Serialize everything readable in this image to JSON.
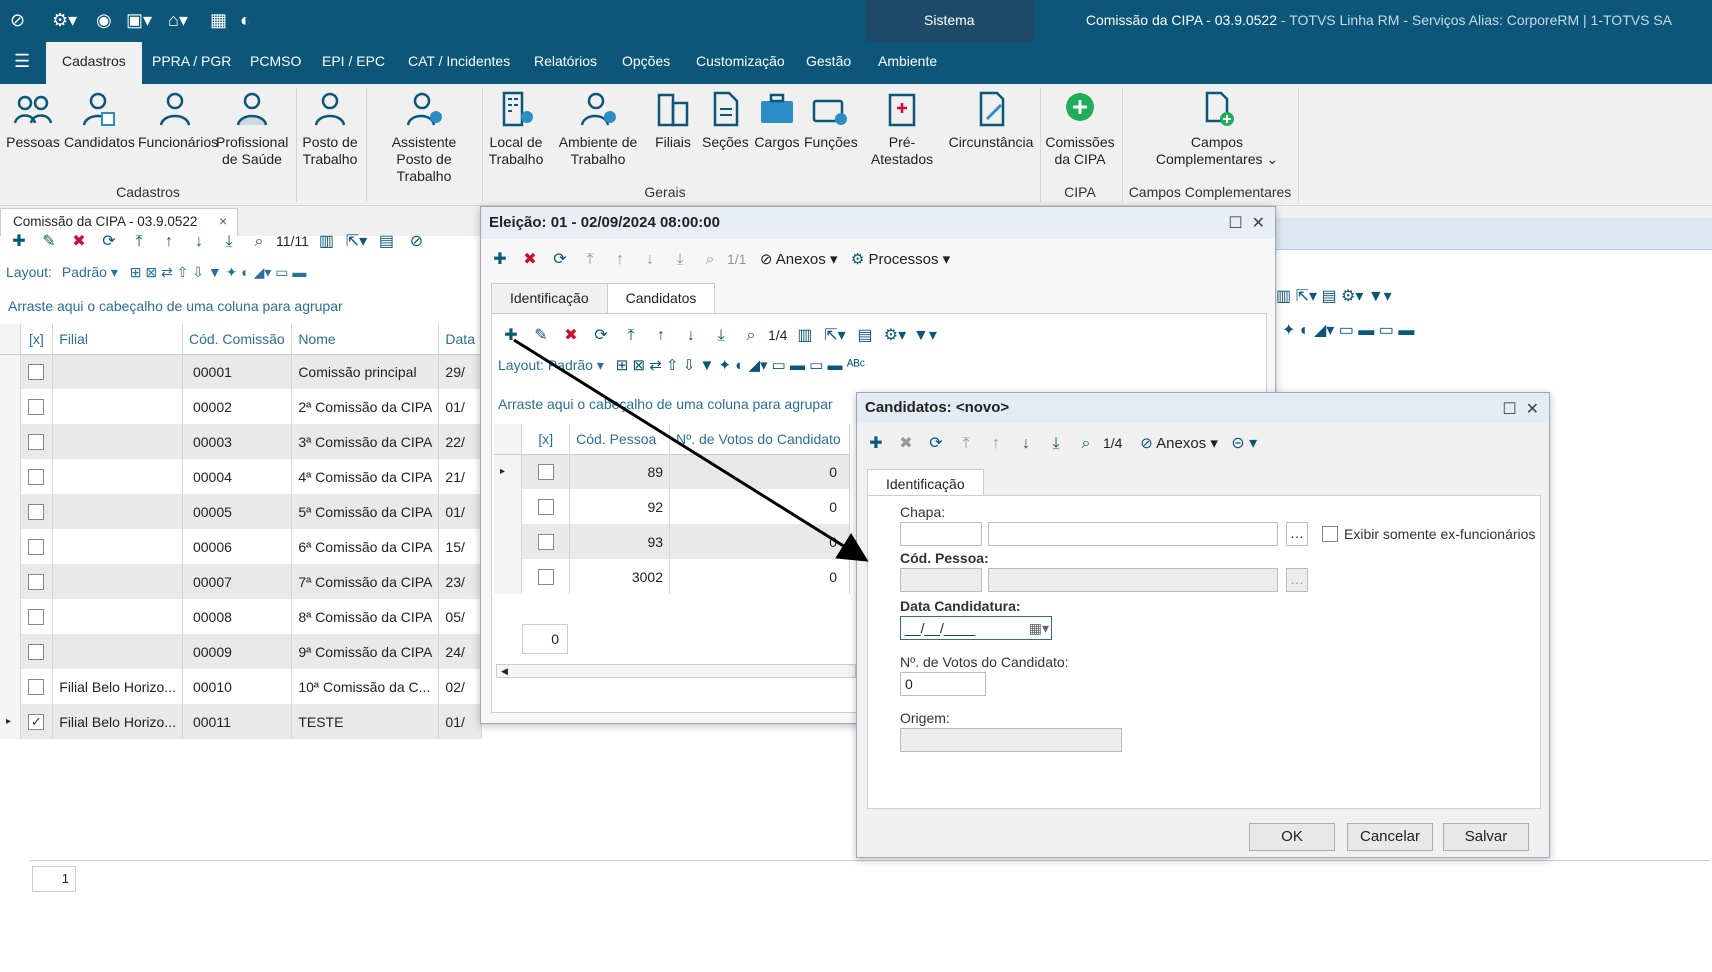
{
  "window": {
    "title_main": "Comissão da CIPA - 03.9.0522",
    "title_rest": " - TOTVS Linha RM - Serviços  Alias: CorporeRM | 1-TOTVS SA",
    "sistema": "Sistema"
  },
  "menu": [
    "Cadastros",
    "PPRA / PGR",
    "PCMSO",
    "EPI / EPC",
    "CAT / Incidentes",
    "Relatórios",
    "Opções",
    "Customização",
    "Gestão",
    "Ambiente"
  ],
  "ribbon": {
    "buttons": [
      "Pessoas",
      "Candidatos",
      "Funcionários",
      "Profissional de Saúde",
      "Posto de Trabalho",
      "Assistente Posto de Trabalho",
      "Local de Trabalho",
      "Ambiente de Trabalho",
      "Filiais",
      "Seções",
      "Cargos",
      "Funções",
      "Pré-Atestados",
      "Circunstância",
      "Comissões da CIPA",
      "Campos Complementares"
    ],
    "groups": [
      "Cadastros",
      "Gerais",
      "CIPA",
      "Campos Complementares"
    ]
  },
  "doctab": {
    "label": "Comissão da CIPA - 03.9.0522",
    "close": "×"
  },
  "main": {
    "record_counter": "11/11",
    "layout_label": "Layout:",
    "layout_value": "Padrão",
    "group_hint": "Arraste aqui o cabeçalho de uma coluna para agrupar",
    "columns": [
      "[x]",
      "Filial",
      "Cód. Comissão",
      "Nome",
      "Data"
    ],
    "rows": [
      {
        "filial": "",
        "cod": "00001",
        "nome": "Comissão principal",
        "data": "29/",
        "checked": false
      },
      {
        "filial": "",
        "cod": "00002",
        "nome": "2ª Comissão da CIPA",
        "data": "01/",
        "checked": false
      },
      {
        "filial": "",
        "cod": "00003",
        "nome": "3ª Comissão da CIPA",
        "data": "22/",
        "checked": false
      },
      {
        "filial": "",
        "cod": "00004",
        "nome": "4ª Comissão da CIPA",
        "data": "21/",
        "checked": false
      },
      {
        "filial": "",
        "cod": "00005",
        "nome": "5ª Comissão da CIPA",
        "data": "01/",
        "checked": false
      },
      {
        "filial": "",
        "cod": "00006",
        "nome": "6ª Comissão da CIPA",
        "data": "15/",
        "checked": false
      },
      {
        "filial": "",
        "cod": "00007",
        "nome": "7ª Comissão da CIPA",
        "data": "23/",
        "checked": false
      },
      {
        "filial": "",
        "cod": "00008",
        "nome": "8ª Comissão da CIPA",
        "data": "05/",
        "checked": false
      },
      {
        "filial": "",
        "cod": "00009",
        "nome": "9ª Comissão da CIPA",
        "data": "24/",
        "checked": false
      },
      {
        "filial": "Filial Belo Horizo...",
        "cod": "00010",
        "nome": "10ª Comissão da C...",
        "data": "02/",
        "checked": false
      },
      {
        "filial": "Filial Belo Horizo...",
        "cod": "00011",
        "nome": "TESTE",
        "data": "01/",
        "checked": true
      }
    ],
    "footer_count": "1"
  },
  "eleicao": {
    "title": "Eleição: 01 - 02/09/2024 08:00:00",
    "counter": "1/1",
    "anexos": "Anexos",
    "processos": "Processos",
    "tabs": [
      "Identificação",
      "Candidatos"
    ],
    "counter2": "1/4",
    "layout_label": "Layout:",
    "layout_value": "Padrão",
    "group_hint": "Arraste aqui o cabeçalho de uma coluna para agrupar",
    "columns": [
      "[x]",
      "Cód. Pessoa",
      "Nº. de Votos do Candidato"
    ],
    "rows": [
      {
        "cod": "89",
        "votos": "0"
      },
      {
        "cod": "92",
        "votos": "0"
      },
      {
        "cod": "93",
        "votos": "0"
      },
      {
        "cod": "3002",
        "votos": "0"
      }
    ],
    "footer_sum": "0"
  },
  "candidatos": {
    "title": "Candidatos: <novo>",
    "counter": "1/4",
    "anexos": "Anexos",
    "tab": "Identificação",
    "chapa_label": "Chapa:",
    "ex_label": "Exibir somente ex-funcionários",
    "cod_label": "Cód. Pessoa:",
    "data_label": "Data Candidatura:",
    "data_value": "__/__/____",
    "votos_label": "Nº. de Votos do Candidato:",
    "votos_value": "0",
    "origem_label": "Origem:",
    "ok": "OK",
    "cancel": "Cancelar",
    "save": "Salvar"
  },
  "colors": {
    "titlebar": "#0b5679",
    "accent": "#2a6f97",
    "delete": "#c8102e",
    "cipa_green": "#1fae5b"
  }
}
